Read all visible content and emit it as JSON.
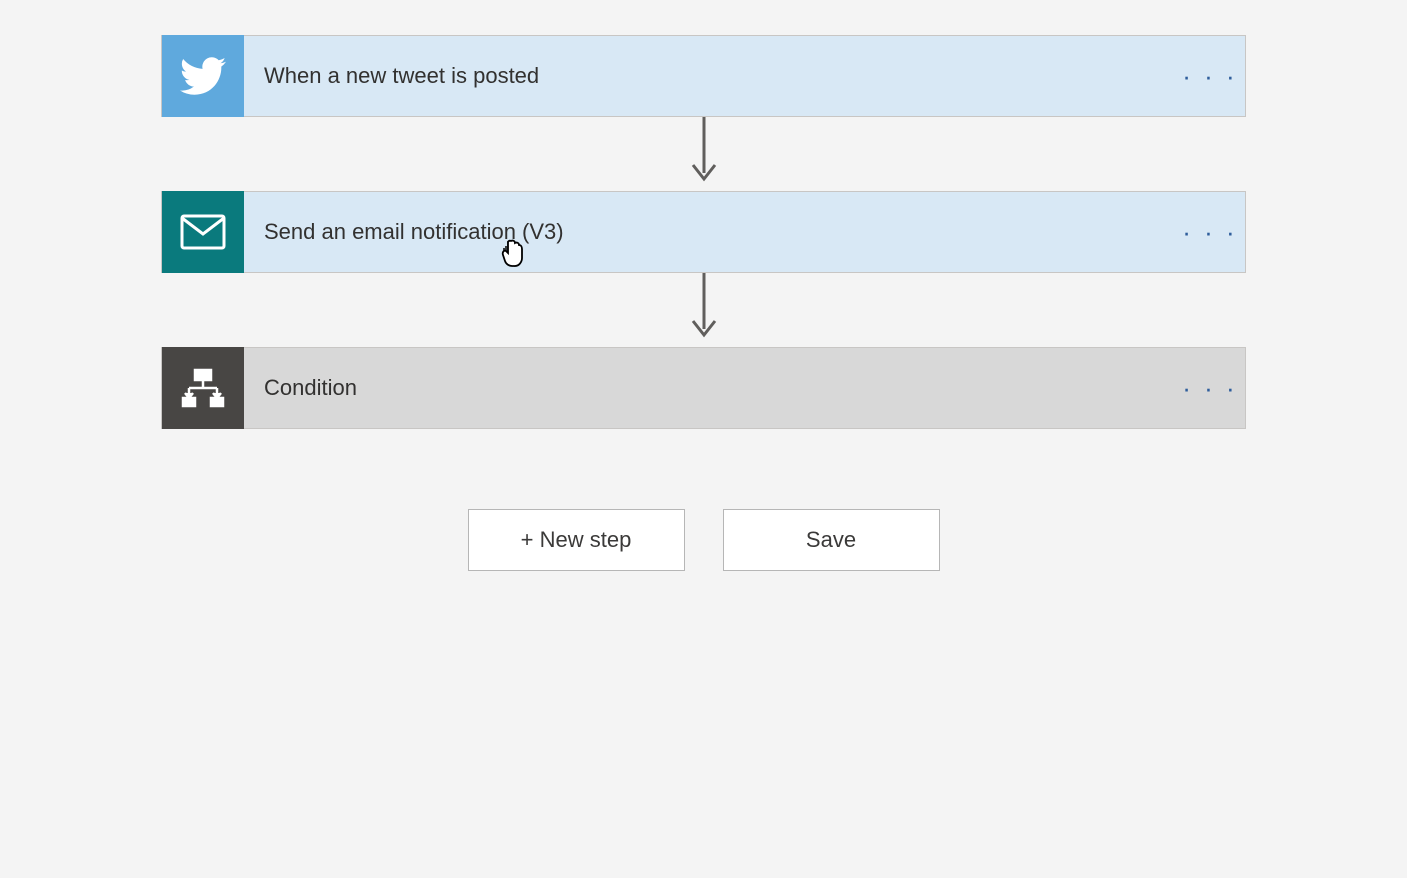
{
  "steps": {
    "twitter": {
      "title": "When a new tweet is posted"
    },
    "email": {
      "title": "Send an email notification (V3)"
    },
    "condition": {
      "title": "Condition"
    }
  },
  "buttons": {
    "newStep": "+ New step",
    "save": "Save"
  },
  "menu": {
    "ellipsis": "· · ·"
  }
}
